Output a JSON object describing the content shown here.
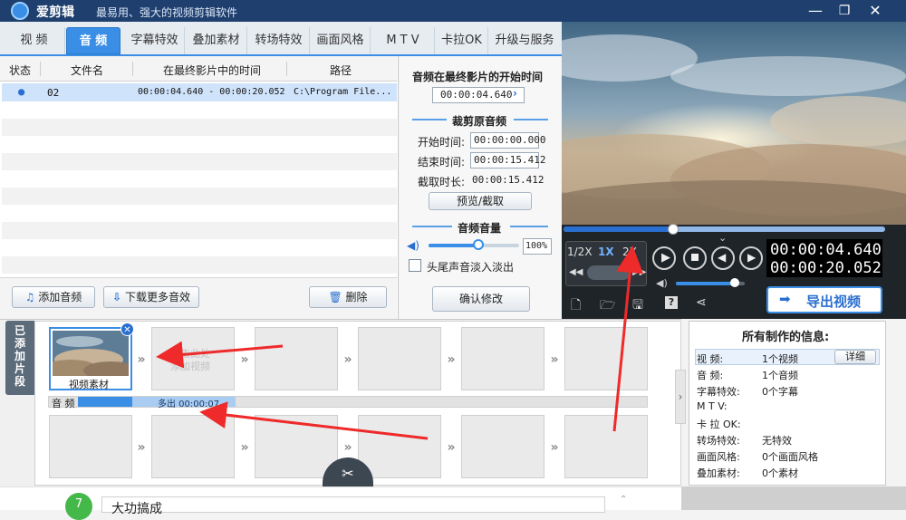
{
  "titlebar": {
    "app_name": "爱剪辑",
    "slogan": "最易用、强大的视频剪辑软件",
    "minimize": "—",
    "maximize": "❐",
    "close": "✕"
  },
  "tabs": [
    "视 频",
    "音 频",
    "字幕特效",
    "叠加素材",
    "转场特效",
    "画面风格",
    "M T V",
    "卡拉OK",
    "升级与服务"
  ],
  "active_tab": 1,
  "list": {
    "headers": [
      "状态",
      "文件名",
      "在最终影片中的时间",
      "路径"
    ],
    "rows": [
      {
        "status": "●",
        "name": "02",
        "time": "00:00:04.640 - 00:00:20.052",
        "path": "C:\\Program File..."
      }
    ]
  },
  "list_buttons": {
    "add_audio": "添加音频",
    "download_more": "下载更多音效",
    "delete": "删除"
  },
  "settings": {
    "start_title": "音频在最终影片的开始时间",
    "start_value": "00:00:04.640",
    "trim_title": "裁剪原音频",
    "start_time_label": "开始时间:",
    "start_time_value": "00:00:00.000",
    "end_time_label": "结束时间:",
    "end_time_value": "00:00:15.412",
    "duration_label": "截取时长:",
    "duration_value": "00:00:15.412",
    "preview_btn": "预览/截取",
    "volume_title": "音频音量",
    "volume_value": "100%",
    "volume_level": 0.55,
    "fade_label": "头尾声音淡入淡出",
    "confirm_btn": "确认修改"
  },
  "player": {
    "progress": 0.34,
    "speeds": [
      "1/2X",
      "1X",
      "2X"
    ],
    "current_time": "00:00:04.640",
    "total_time": "00:00:20.052",
    "volume_level": 0.85,
    "export_btn": "导出视频"
  },
  "timeline": {
    "side_tab": "已添加片段",
    "clip_label": "视频素材",
    "placeholder1": "双击此处",
    "placeholder2": "添加视频",
    "audio_label": "音 频",
    "audio_clip_text": "多出 00:00:07"
  },
  "info": {
    "title": "所有制作的信息:",
    "detail_btn": "详细",
    "rows": [
      {
        "key": "视  频:",
        "value": "1个视频"
      },
      {
        "key": "音  频:",
        "value": "1个音频"
      },
      {
        "key": "字幕特效:",
        "value": "0个字幕"
      },
      {
        "key": "M T V:",
        "value": ""
      },
      {
        "key": "卡 拉 OK:",
        "value": ""
      },
      {
        "key": "转场特效:",
        "value": "无特效"
      },
      {
        "key": "画面风格:",
        "value": "0个画面风格"
      },
      {
        "key": "叠加素材:",
        "value": "0个素材"
      }
    ]
  },
  "bottom": {
    "step_number": "7",
    "step_text": "大功搞成"
  },
  "colors": {
    "accent": "#3a8ee6",
    "arrow": "#ee2a2a",
    "export": "#2a6fd0"
  }
}
